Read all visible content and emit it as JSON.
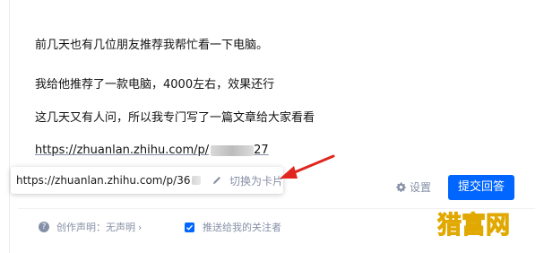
{
  "editor": {
    "line1": "前几天也有几位朋友推荐我帮忙看一下电脑。",
    "line2": "我给他推荐了一款电脑，4000左右，效果还行",
    "line3": "这几天又有人问，所以我专门写了一篇文章给大家看看",
    "link_prefix": "https://zhuanlan.zhihu.com/p/",
    "link_suffix": "27"
  },
  "link_popup": {
    "url": "https://zhuanlan.zhihu.com/p/",
    "url_tail": "36",
    "edit_icon": "pencil-icon",
    "switch_label": "切换为卡片"
  },
  "toolbar": {
    "settings_icon": "gear-icon",
    "settings_label": "设置",
    "submit_label": "提交回答"
  },
  "footer": {
    "help_icon": "question-circle-icon",
    "statement_label": "创作声明：无声明",
    "statement_chevron": "›",
    "push_checked": true,
    "push_label": "推送给我的关注者"
  },
  "watermark": "猎富网",
  "colors": {
    "accent": "#0066ff",
    "muted": "#8590a6",
    "annotation_arrow": "#e0261f",
    "watermark": "#f2c400"
  }
}
